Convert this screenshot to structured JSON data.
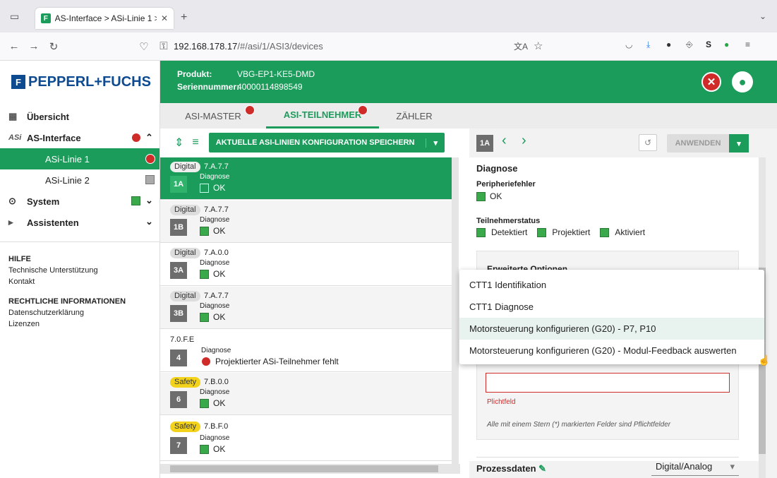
{
  "browser": {
    "tab_title": "AS-Interface > ASi-Linie 1 > AS",
    "url_host": "192.168.178.17",
    "url_path": "/#/asi/1/ASI3/devices",
    "new_tab": "+"
  },
  "header": {
    "logo": "PEPPERL+FUCHS",
    "product_label": "Produkt:",
    "product_value": "VBG-EP1-KE5-DMD",
    "serial_label": "Seriennummer:",
    "serial_value": "40000114898549"
  },
  "sidebar": {
    "overview": "Übersicht",
    "asi": "AS-Interface",
    "line1": "ASi-Linie 1",
    "line2": "ASi-Linie 2",
    "system": "System",
    "assistants": "Assistenten",
    "help_title": "HILFE",
    "help_items": [
      "Technische Unterstützung",
      "Kontakt"
    ],
    "legal_title": "RECHTLICHE INFORMATIONEN",
    "legal_items": [
      "Datenschutzerklärung",
      "Lizenzen"
    ]
  },
  "tabs": [
    "ASI-MASTER",
    "ASI-TEILNEHMER",
    "ZÄHLER"
  ],
  "list_toolbar": {
    "save": "AKTUELLE ASI-LINIEN KONFIGURATION SPEICHERN"
  },
  "devices": [
    {
      "type": "Digital",
      "code": "7.A.7.7",
      "num": "1A",
      "diag_label": "Diagnose",
      "status": "OK"
    },
    {
      "type": "Digital",
      "code": "7.A.7.7",
      "num": "1B",
      "diag_label": "Diagnose",
      "status": "OK"
    },
    {
      "type": "Digital",
      "code": "7.A.0.0",
      "num": "3A",
      "diag_label": "Diagnose",
      "status": "OK"
    },
    {
      "type": "Digital",
      "code": "7.A.7.7",
      "num": "3B",
      "diag_label": "Diagnose",
      "status": "OK"
    },
    {
      "type": "",
      "code": "7.0.F.E",
      "num": "4",
      "diag_label": "Diagnose",
      "status": "Projektierter ASi-Teilnehmer fehlt"
    },
    {
      "type": "Safety",
      "code": "7.B.0.0",
      "num": "6",
      "diag_label": "Diagnose",
      "status": "OK"
    },
    {
      "type": "Safety",
      "code": "7.B.F.0",
      "num": "7",
      "diag_label": "Diagnose",
      "status": "OK"
    }
  ],
  "detail": {
    "num": "1A",
    "apply": "ANWENDEN",
    "diag_title": "Diagnose",
    "periph_label": "Peripheriefehler",
    "periph_value": "OK",
    "status_label": "Teilnehmerstatus",
    "status_items": [
      "Detektiert",
      "Projektiert",
      "Aktiviert"
    ],
    "ext_options": "Erweiterte Optionen",
    "required_field": "Plichtfeld",
    "required_note": "Alle mit einem Stern (*) markierten Felder sind Pflichtfelder",
    "process_title": "Prozessdaten",
    "process_select": "Digital/Analog"
  },
  "dropdown": [
    "CTT1 Identifikation",
    "CTT1 Diagnose",
    "Motorsteuerung konfigurieren (G20) - P7, P10",
    "Motorsteuerung konfigurieren (G20) - Modul-Feedback auswerten"
  ],
  "colors": {
    "brand_green": "#1c9c5b",
    "error_red": "#cf2b28",
    "logo_blue": "#0d4a8f"
  }
}
